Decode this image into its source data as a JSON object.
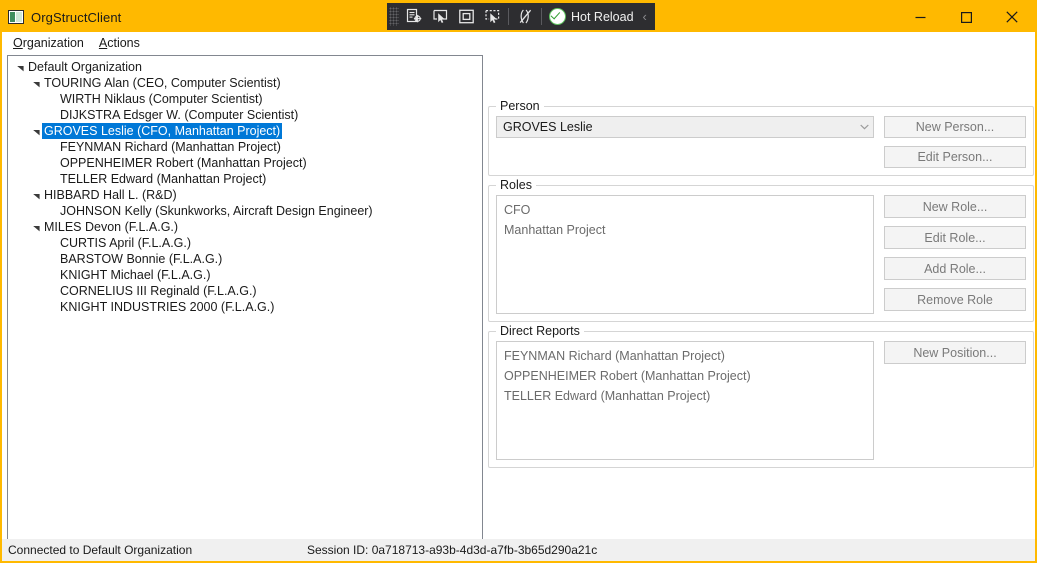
{
  "window": {
    "title": "OrgStructClient",
    "app_icon": "app-window-icon",
    "accent_color": "#FFB900",
    "controls": {
      "minimize": "minimize-icon",
      "maximize": "maximize-icon",
      "close": "close-icon"
    }
  },
  "vs_toolbar": {
    "grip": "drag-grip",
    "buttons": [
      {
        "icon": "go-to-live-visual-tree-icon"
      },
      {
        "icon": "select-element-icon"
      },
      {
        "icon": "display-layout-adorner-icon"
      },
      {
        "icon": "track-focused-element-icon"
      },
      {
        "icon": "enable-disable-xaml-hot-reload-icon"
      }
    ],
    "hot_reload": {
      "label": "Hot Reload",
      "icon": "hot-reload-check-icon",
      "icon_color": "#3f9e3f"
    },
    "chevron": "‹"
  },
  "menubar": {
    "items": [
      {
        "label": "Organization",
        "accesskey": "O"
      },
      {
        "label": "Actions",
        "accesskey": "A"
      }
    ]
  },
  "tree": {
    "nodes": [
      {
        "level": 0,
        "expander": "expanded",
        "label": "Default Organization",
        "selected": false
      },
      {
        "level": 1,
        "expander": "expanded",
        "label": "TOURING Alan  (CEO, Computer Scientist)",
        "selected": false
      },
      {
        "level": 2,
        "expander": "none",
        "label": "WIRTH Niklaus  (Computer Scientist)",
        "selected": false
      },
      {
        "level": 2,
        "expander": "none",
        "label": "DIJKSTRA Edsger W.  (Computer Scientist)",
        "selected": false
      },
      {
        "level": 1,
        "expander": "expanded",
        "label": "GROVES Leslie  (CFO, Manhattan Project)",
        "selected": true
      },
      {
        "level": 2,
        "expander": "none",
        "label": "FEYNMAN Richard  (Manhattan Project)",
        "selected": false
      },
      {
        "level": 2,
        "expander": "none",
        "label": "OPPENHEIMER Robert  (Manhattan Project)",
        "selected": false
      },
      {
        "level": 2,
        "expander": "none",
        "label": "TELLER Edward  (Manhattan Project)",
        "selected": false
      },
      {
        "level": 1,
        "expander": "expanded",
        "label": "HIBBARD Hall L.  (R&D)",
        "selected": false
      },
      {
        "level": 2,
        "expander": "none",
        "label": "JOHNSON Kelly  (Skunkworks, Aircraft Design Engineer)",
        "selected": false
      },
      {
        "level": 1,
        "expander": "expanded",
        "label": "MILES Devon  (F.L.A.G.)",
        "selected": false
      },
      {
        "level": 2,
        "expander": "none",
        "label": "CURTIS April  (F.L.A.G.)",
        "selected": false
      },
      {
        "level": 2,
        "expander": "none",
        "label": "BARSTOW Bonnie  (F.L.A.G.)",
        "selected": false
      },
      {
        "level": 2,
        "expander": "none",
        "label": "KNIGHT Michael  (F.L.A.G.)",
        "selected": false
      },
      {
        "level": 2,
        "expander": "none",
        "label": "CORNELIUS III Reginald  (F.L.A.G.)",
        "selected": false
      },
      {
        "level": 2,
        "expander": "none",
        "label": "KNIGHT INDUSTRIES 2000  (F.L.A.G.)",
        "selected": false
      }
    ],
    "selection_color": "#0078D7"
  },
  "person_group": {
    "title": "Person",
    "combo": {
      "value": "GROVES Leslie",
      "placeholder": "",
      "arrow_icon": "chevron-down-icon"
    },
    "buttons": [
      {
        "label": "New Person..."
      },
      {
        "label": "Edit Person..."
      }
    ]
  },
  "roles_group": {
    "title": "Roles",
    "items": [
      "CFO",
      "Manhattan Project"
    ],
    "buttons": [
      {
        "label": "New Role..."
      },
      {
        "label": "Edit Role..."
      },
      {
        "label": "Add Role..."
      },
      {
        "label": "Remove Role"
      }
    ]
  },
  "direct_reports_group": {
    "title": "Direct Reports",
    "items": [
      "FEYNMAN Richard  (Manhattan Project)",
      "OPPENHEIMER Robert  (Manhattan Project)",
      "TELLER Edward  (Manhattan Project)"
    ],
    "buttons": [
      {
        "label": "New Position..."
      }
    ]
  },
  "statusbar": {
    "connection": "Connected to Default Organization",
    "session": "Session ID: 0a718713-a93b-4d3d-a7fb-3b65d290a21c"
  }
}
